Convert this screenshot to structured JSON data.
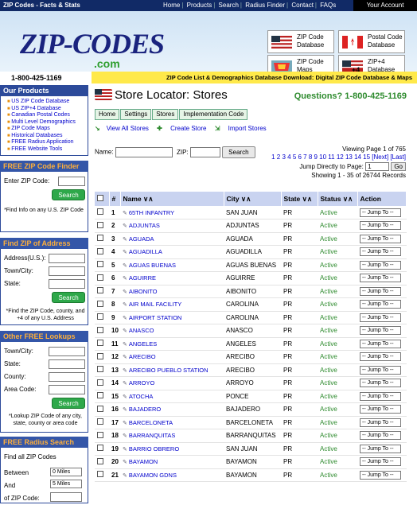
{
  "topbar": {
    "site": "ZIP Codes - Facts & Stats",
    "nav": [
      "Home",
      "Products",
      "Search",
      "Radius Finder",
      "Contact",
      "FAQs"
    ],
    "account": "Your Account"
  },
  "header": {
    "logo": "ZIP-CODES",
    "logo_sub": ".com",
    "boxes": [
      {
        "label": "ZIP Code Database"
      },
      {
        "label": "Postal Code Database"
      },
      {
        "label": "ZIP Code Maps"
      },
      {
        "label": "ZIP+4 Database"
      }
    ]
  },
  "phone": "1-800-425-1169",
  "download": "ZIP Code List & Demographics Database Download: Digital ZIP Code Database & Maps",
  "sidebar": {
    "products_title": "Our Products",
    "products": [
      "US ZIP Code Database",
      "US ZIP+4 Database",
      "Canadian Postal Codes",
      "Multi Level Demographics",
      "ZIP Code Maps",
      "Historical Databases",
      "FREE Radius Application",
      "FREE Website Tools"
    ],
    "finder_title": "FREE ZIP Code Finder",
    "finder_label": "Enter ZIP Code:",
    "finder_btn": "Search",
    "finder_note": "*Find Info on any U.S. ZIP Code",
    "address_title": "Find ZIP of Address",
    "address_l1": "Address(U.S.):",
    "address_l2": "Town/City:",
    "address_l3": "State:",
    "address_btn": "Search",
    "address_note": "*Find the ZIP Code, county, and +4 of any U.S. Address",
    "lookup_title": "Other FREE Lookups",
    "lookup_l1": "Town/City:",
    "lookup_l2": "State:",
    "lookup_l3": "County:",
    "lookup_l4": "Area Code:",
    "lookup_btn": "Search",
    "lookup_note": "*Lookup ZIP Code of any city, state, county or area code",
    "radius_title": "FREE Radius Search",
    "radius_l0": "Find all ZIP Codes",
    "radius_l1": "Between",
    "radius_v1": "0 Miles",
    "radius_l2": "And",
    "radius_v2": "5 Miles",
    "radius_l3": "of ZIP Code:"
  },
  "main": {
    "title": "Store Locator: Stores",
    "question": "Questions? 1-800-425-1169",
    "tabs": [
      "Home",
      "Settings",
      "Stores",
      "Implementation Code"
    ],
    "actions": [
      "View All Stores",
      "Create Store",
      "Import Stores"
    ],
    "name_label": "Name:",
    "zip_label": "ZIP:",
    "search_btn": "Search",
    "viewing": "Viewing Page 1 of 765",
    "pages": "1 2 3 4 5 6 7 8 9 10 11 12 13 14 15 [Next] [Last]",
    "jump_label": "Jump Directly to Page:",
    "jump_value": "1",
    "go": "Go",
    "showing": "Showing 1 - 35 of 26744 Records",
    "columns": [
      "#",
      "Name ∨∧",
      "City ∨∧",
      "State ∨∧",
      "Status ∨∧",
      "Action"
    ],
    "jump_to": "-- Jump To --",
    "rows": [
      {
        "n": "1",
        "name": "65TH INFANTRY",
        "city": "SAN JUAN",
        "state": "PR",
        "status": "Active"
      },
      {
        "n": "2",
        "name": "ADJUNTAS",
        "city": "ADJUNTAS",
        "state": "PR",
        "status": "Active"
      },
      {
        "n": "3",
        "name": "AGUADA",
        "city": "AGUADA",
        "state": "PR",
        "status": "Active"
      },
      {
        "n": "4",
        "name": "AGUADILLA",
        "city": "AGUADILLA",
        "state": "PR",
        "status": "Active"
      },
      {
        "n": "5",
        "name": "AGUAS BUENAS",
        "city": "AGUAS BUENAS",
        "state": "PR",
        "status": "Active"
      },
      {
        "n": "6",
        "name": "AGUIRRE",
        "city": "AGUIRRE",
        "state": "PR",
        "status": "Active"
      },
      {
        "n": "7",
        "name": "AIBONITO",
        "city": "AIBONITO",
        "state": "PR",
        "status": "Active"
      },
      {
        "n": "8",
        "name": "AIR MAIL FACILITY",
        "city": "CAROLINA",
        "state": "PR",
        "status": "Active"
      },
      {
        "n": "9",
        "name": "AIRPORT STATION",
        "city": "CAROLINA",
        "state": "PR",
        "status": "Active"
      },
      {
        "n": "10",
        "name": "ANASCO",
        "city": "ANASCO",
        "state": "PR",
        "status": "Active"
      },
      {
        "n": "11",
        "name": "ANGELES",
        "city": "ANGELES",
        "state": "PR",
        "status": "Active"
      },
      {
        "n": "12",
        "name": "ARECIBO",
        "city": "ARECIBO",
        "state": "PR",
        "status": "Active"
      },
      {
        "n": "13",
        "name": "ARECIBO PUEBLO STATION",
        "city": "ARECIBO",
        "state": "PR",
        "status": "Active"
      },
      {
        "n": "14",
        "name": "ARROYO",
        "city": "ARROYO",
        "state": "PR",
        "status": "Active"
      },
      {
        "n": "15",
        "name": "ATOCHA",
        "city": "PONCE",
        "state": "PR",
        "status": "Active"
      },
      {
        "n": "16",
        "name": "BAJADERO",
        "city": "BAJADERO",
        "state": "PR",
        "status": "Active"
      },
      {
        "n": "17",
        "name": "BARCELONETA",
        "city": "BARCELONETA",
        "state": "PR",
        "status": "Active"
      },
      {
        "n": "18",
        "name": "BARRANQUITAS",
        "city": "BARRANQUITAS",
        "state": "PR",
        "status": "Active"
      },
      {
        "n": "19",
        "name": "BARRIO OBRERO",
        "city": "SAN JUAN",
        "state": "PR",
        "status": "Active"
      },
      {
        "n": "20",
        "name": "BAYAMON",
        "city": "BAYAMON",
        "state": "PR",
        "status": "Active"
      },
      {
        "n": "21",
        "name": "BAYAMON GDNS",
        "city": "BAYAMON",
        "state": "PR",
        "status": "Active"
      }
    ]
  }
}
